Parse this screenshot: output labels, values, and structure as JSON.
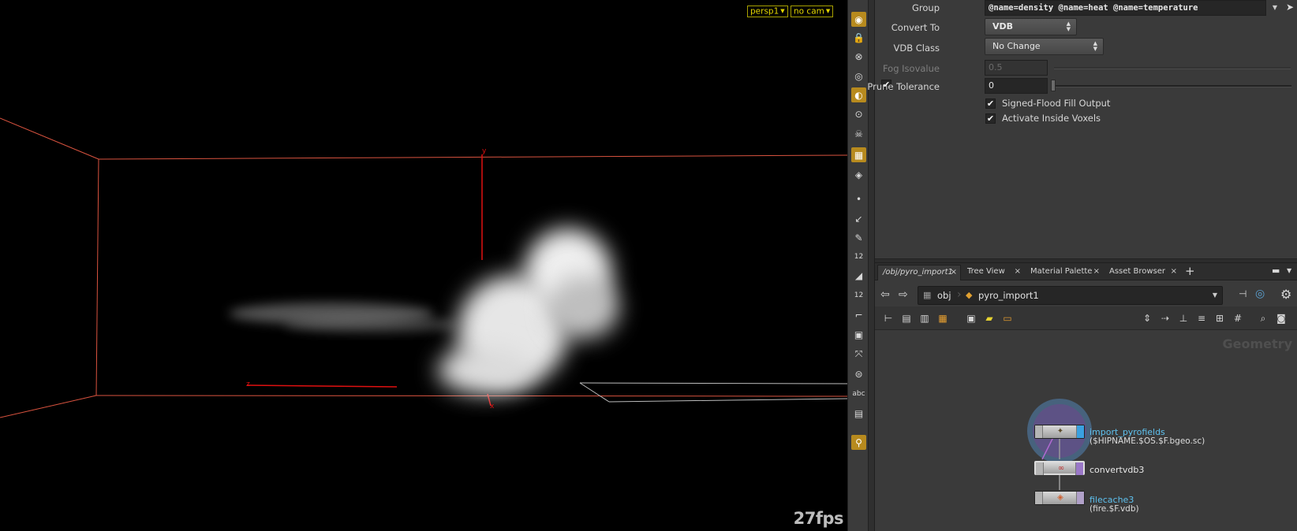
{
  "viewport": {
    "camera_menu": "persp1",
    "cam_menu": "no cam",
    "fps": "27fps",
    "axis_labels": {
      "y": "y",
      "z": "z",
      "x": "x"
    }
  },
  "toolbar": {
    "text_tool": "abc"
  },
  "parameters": {
    "group": {
      "label": "Group",
      "value": "@name=density @name=heat @name=temperature"
    },
    "convert_to": {
      "label": "Convert To",
      "value": "VDB"
    },
    "vdb_class": {
      "label": "VDB Class",
      "value": "No Change"
    },
    "fog_isovalue": {
      "label": "Fog Isovalue",
      "value": "0.5"
    },
    "prune_tolerance": {
      "label": "Prune Tolerance",
      "value": "0"
    },
    "signed_flood_fill": {
      "label": "Signed-Flood Fill Output",
      "checked": true
    },
    "activate_inside_voxels": {
      "label": "Activate Inside Voxels",
      "checked": true
    }
  },
  "network": {
    "tabs": [
      {
        "label": "/obj/pyro_import1",
        "active": true
      },
      {
        "label": "Tree View"
      },
      {
        "label": "Material Palette"
      },
      {
        "label": "Asset Browser"
      }
    ],
    "path": {
      "root": "obj",
      "current": "pyro_import1"
    },
    "context_label": "Geometry",
    "nodes": [
      {
        "name": "import_pyrofields",
        "subtitle": "($HIPNAME.$OS.$F.bgeo.sc)"
      },
      {
        "name": "convertvdb3",
        "subtitle": ""
      },
      {
        "name": "filecache3",
        "subtitle": "(fire.$F.vdb)"
      }
    ]
  },
  "colors": {
    "viewport_bg": "#000000",
    "bbox_line": "#e0503c",
    "axis": "#e01010",
    "cam_button": "#e3d600",
    "node_highlight": "#5ec1ef",
    "selection_circle": "#4a6a8a"
  }
}
